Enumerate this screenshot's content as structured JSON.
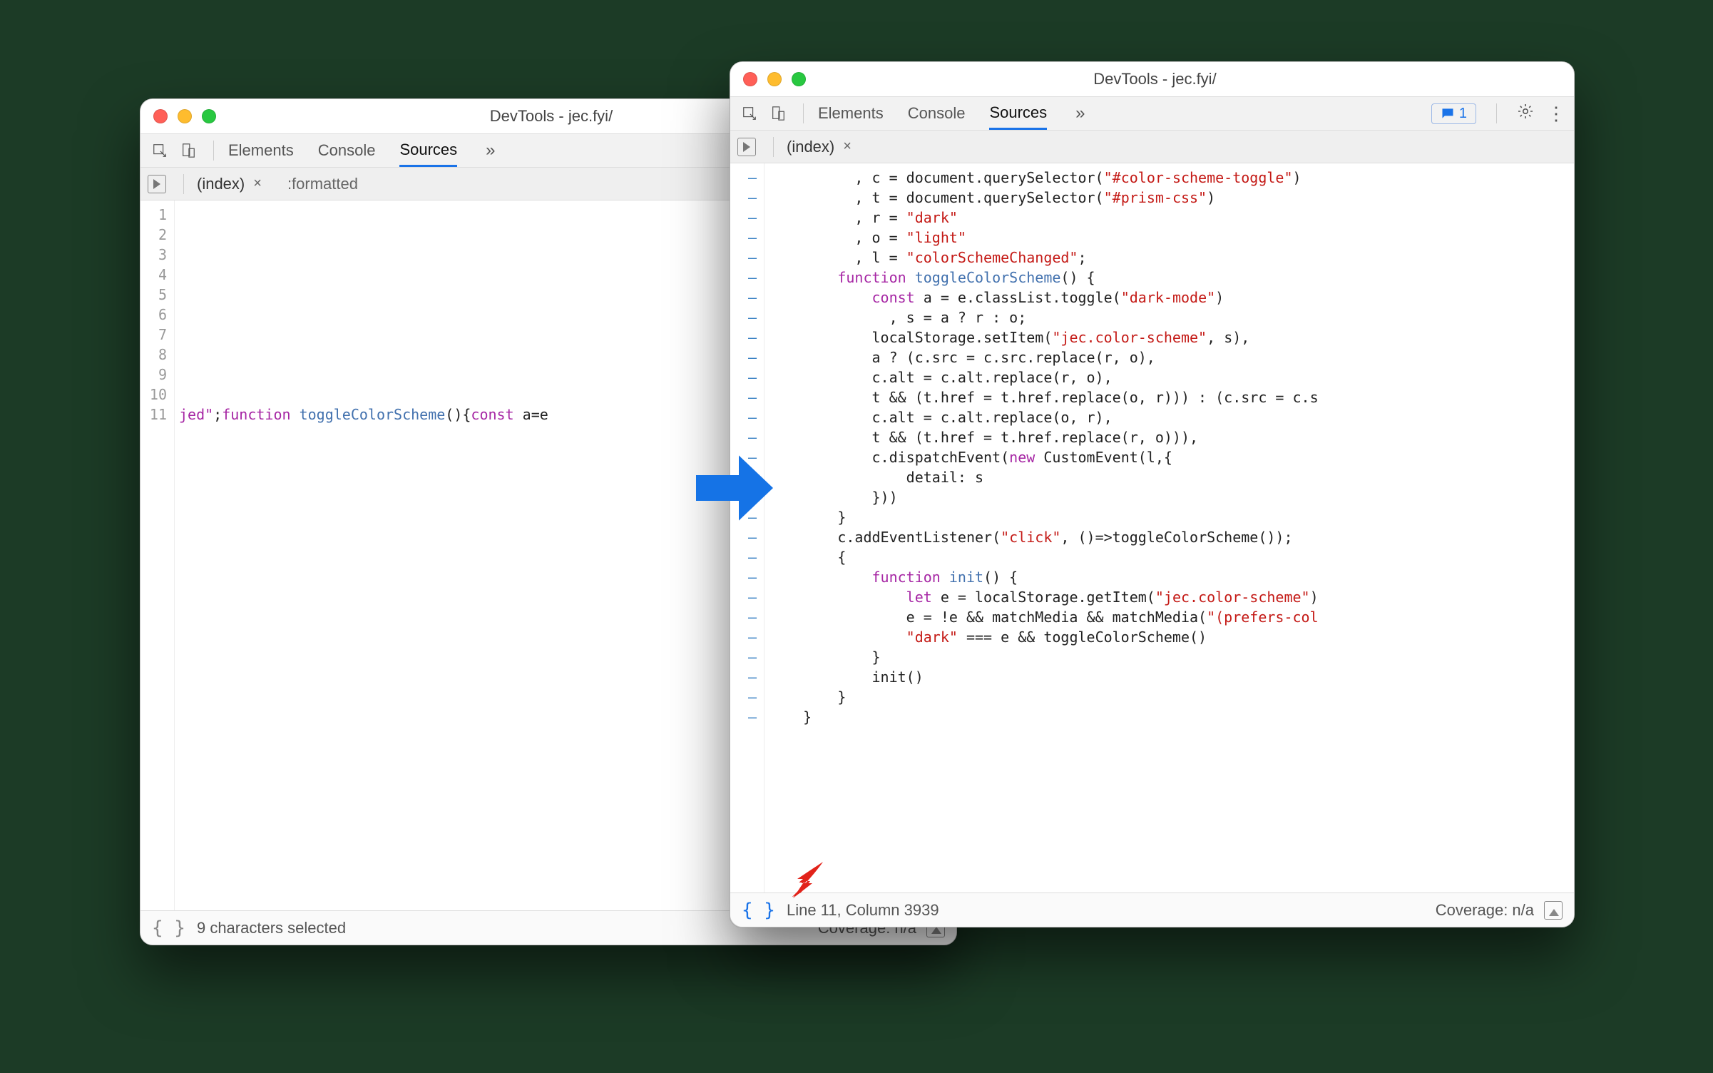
{
  "windowLeft": {
    "title": "DevTools - jec.fyi/",
    "tabs": {
      "elements": "Elements",
      "console": "Console",
      "sources": "Sources"
    },
    "fileTabs": {
      "index": "(index)",
      "formatted": ":formatted"
    },
    "gutterLines": [
      "1",
      "2",
      "3",
      "4",
      "5",
      "6",
      "7",
      "8",
      "9",
      "10",
      "11"
    ],
    "codeLine11": {
      "pre": "jed\"",
      "kw1": "function",
      "fn": "toggleColorScheme",
      "mid": "(){",
      "kw2": "const",
      "tail": " a=e"
    },
    "status": {
      "selection": "9 characters selected",
      "coverage": "Coverage: n/a"
    }
  },
  "windowRight": {
    "title": "DevTools - jec.fyi/",
    "tabs": {
      "elements": "Elements",
      "console": "Console",
      "sources": "Sources"
    },
    "issuesBadge": "1",
    "fileTabs": {
      "index": "(index)"
    },
    "dashCount": 26,
    "codeLines": [
      [
        [
          "p",
          "          , c = document.querySelector("
        ],
        [
          "s",
          "\"#color-scheme-toggle\""
        ],
        [
          "p",
          ")"
        ]
      ],
      [
        [
          "p",
          "          , t = document.querySelector("
        ],
        [
          "s",
          "\"#prism-css\""
        ],
        [
          "p",
          ")"
        ]
      ],
      [
        [
          "p",
          "          , r = "
        ],
        [
          "s",
          "\"dark\""
        ]
      ],
      [
        [
          "p",
          "          , o = "
        ],
        [
          "s",
          "\"light\""
        ]
      ],
      [
        [
          "p",
          "          , l = "
        ],
        [
          "s",
          "\"colorSchemeChanged\""
        ],
        [
          "p",
          ";"
        ]
      ],
      [
        [
          "p",
          "        "
        ],
        [
          "k",
          "function"
        ],
        [
          "p",
          " "
        ],
        [
          "f",
          "toggleColorScheme"
        ],
        [
          "p",
          "() {"
        ]
      ],
      [
        [
          "p",
          "            "
        ],
        [
          "k",
          "const"
        ],
        [
          "p",
          " a = e.classList.toggle("
        ],
        [
          "s",
          "\"dark-mode\""
        ],
        [
          "p",
          ")"
        ]
      ],
      [
        [
          "p",
          "              , s = a ? r : o;"
        ]
      ],
      [
        [
          "p",
          "            localStorage.setItem("
        ],
        [
          "s",
          "\"jec.color-scheme\""
        ],
        [
          "p",
          ", s),"
        ]
      ],
      [
        [
          "p",
          "            a ? (c.src = c.src.replace(r, o),"
        ]
      ],
      [
        [
          "p",
          "            c.alt = c.alt.replace(r, o),"
        ]
      ],
      [
        [
          "p",
          "            t && (t.href = t.href.replace(o, r))) : (c.src = c.s"
        ]
      ],
      [
        [
          "p",
          "            c.alt = c.alt.replace(o, r),"
        ]
      ],
      [
        [
          "p",
          "            t && (t.href = t.href.replace(r, o))),"
        ]
      ],
      [
        [
          "p",
          "            c.dispatchEvent("
        ],
        [
          "k",
          "new"
        ],
        [
          "p",
          " CustomEvent(l,{"
        ]
      ],
      [
        [
          "p",
          "                detail: s"
        ]
      ],
      [
        [
          "p",
          "            }))"
        ]
      ],
      [
        [
          "p",
          "        }"
        ]
      ],
      [
        [
          "p",
          "        c.addEventListener("
        ],
        [
          "s",
          "\"click\""
        ],
        [
          "p",
          ", ()=>toggleColorScheme());"
        ]
      ],
      [
        [
          "p",
          "        {"
        ]
      ],
      [
        [
          "p",
          "            "
        ],
        [
          "k",
          "function"
        ],
        [
          "p",
          " "
        ],
        [
          "f",
          "init"
        ],
        [
          "p",
          "() {"
        ]
      ],
      [
        [
          "p",
          "                "
        ],
        [
          "k",
          "let"
        ],
        [
          "p",
          " e = localStorage.getItem("
        ],
        [
          "s",
          "\"jec.color-scheme\""
        ],
        [
          "p",
          ")"
        ]
      ],
      [
        [
          "p",
          "                e = !e && matchMedia && matchMedia("
        ],
        [
          "s",
          "\"(prefers-col"
        ]
      ],
      [
        [
          "p",
          "                "
        ],
        [
          "s",
          "\"dark\""
        ],
        [
          "p",
          " === e && toggleColorScheme()"
        ]
      ],
      [
        [
          "p",
          "            }"
        ]
      ],
      [
        [
          "p",
          "            init()"
        ]
      ],
      [
        [
          "p",
          "        }"
        ]
      ],
      [
        [
          "p",
          "    }"
        ]
      ]
    ],
    "status": {
      "cursor": "Line 11, Column 3939",
      "coverage": "Coverage: n/a"
    }
  }
}
